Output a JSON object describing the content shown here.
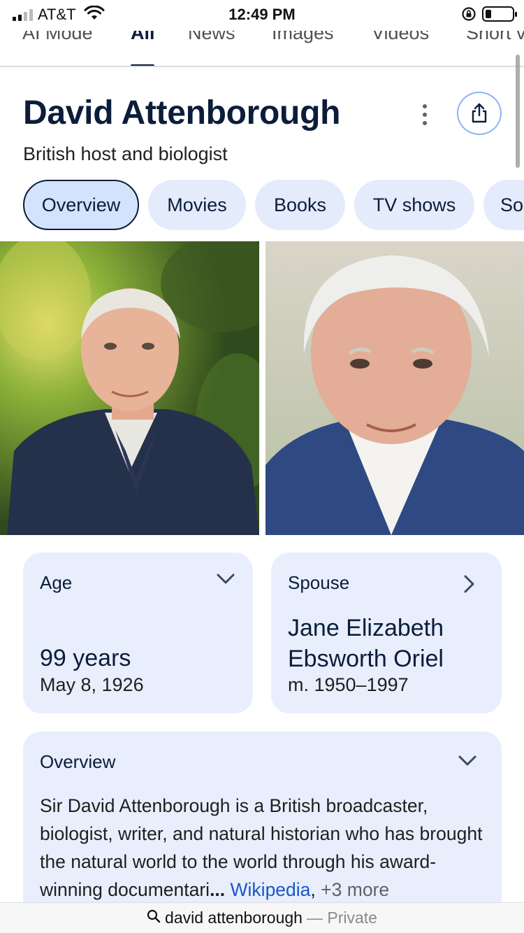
{
  "status_bar": {
    "carrier": "AT&T",
    "time": "12:49 PM"
  },
  "search_tabs": [
    {
      "label": "AI Mode",
      "active": false
    },
    {
      "label": "All",
      "active": true
    },
    {
      "label": "News",
      "active": false
    },
    {
      "label": "Images",
      "active": false
    },
    {
      "label": "Videos",
      "active": false
    },
    {
      "label": "Short v",
      "active": false
    }
  ],
  "knowledge_panel": {
    "title": "David Attenborough",
    "subtitle": "British host and biologist",
    "chips": [
      "Overview",
      "Movies",
      "Books",
      "TV shows",
      "So"
    ],
    "selected_chip": "Overview"
  },
  "facts": {
    "age": {
      "label": "Age",
      "value": "99 years",
      "sub": "May 8, 1926"
    },
    "spouse": {
      "label": "Spouse",
      "value": "Jane Elizabeth Ebsworth Oriel",
      "sub": "m. 1950–1997"
    }
  },
  "overview": {
    "title": "Overview",
    "text": "Sir David Attenborough is a British broadcaster, biologist, writer, and natural historian who has brought the natural world to the world through his award-winning documentari",
    "ellipsis": "...",
    "source": "Wikipedia",
    "sep": ",",
    "more": "+3 more"
  },
  "bottom_bar": {
    "query": "david attenborough",
    "mode": "— Private"
  },
  "colors": {
    "title": "#0b1d3a",
    "chip_bg": "#e4ebfb",
    "card_bg": "#e8eefc",
    "link": "#1a56c9"
  }
}
